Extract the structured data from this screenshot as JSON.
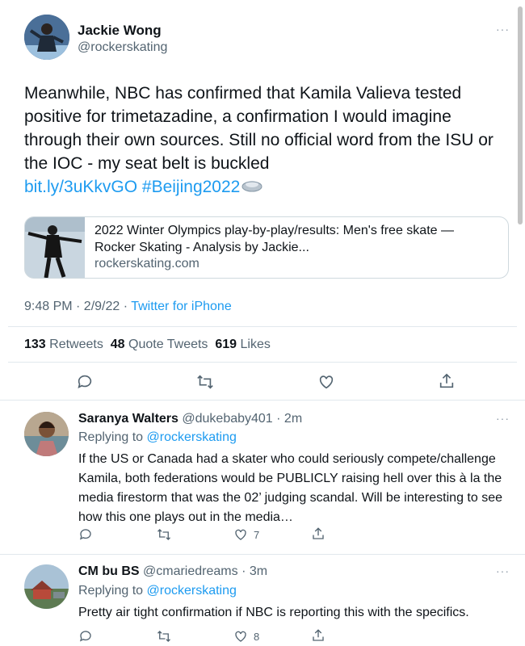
{
  "main_tweet": {
    "name": "Jackie Wong",
    "handle": "@rockerskating",
    "more": "···",
    "text": "Meanwhile, NBC has confirmed that Kamila Valieva tested positive for trimetazadine, a confirmation I would imagine through their own sources. Still no official word from the ISU or the IOC - my seat belt is buckled",
    "link": "bit.ly/3uKkvGO",
    "hashtag": "#Beijing2022",
    "card": {
      "title": "2022 Winter Olympics play-by-play/results: Men's free skate — Rocker Skating - Analysis by Jackie...",
      "domain": "rockerskating.com"
    },
    "time": "9:48 PM · 2/9/22 · ",
    "source": "Twitter for iPhone",
    "retweets_count": "133",
    "retweets_label": "Retweets",
    "quote_count": "48",
    "quote_label": "Quote Tweets",
    "likes_count": "619",
    "likes_label": "Likes"
  },
  "replies": [
    {
      "name": "Saranya Walters",
      "handle": "@dukebaby401",
      "time": "· 2m",
      "replying_prefix": "Replying to ",
      "replying_to": "@rockerskating",
      "text": "If the US or Canada had a skater who could seriously compete/challenge Kamila, both federations would be PUBLICLY raising hell over this à la the media firestorm that was the 02’ judging scandal. Will be interesting to see how this one plays out in the media…",
      "likes": "7"
    },
    {
      "name": "CM bu BS",
      "handle": "@cmariedreams",
      "time": "· 3m",
      "replying_prefix": "Replying to ",
      "replying_to": "@rockerskating",
      "text": "Pretty air tight confirmation if NBC is reporting this with the specifics.",
      "likes": "8"
    }
  ],
  "icons": [
    "reply-icon",
    "retweet-icon",
    "like-icon",
    "share-icon",
    "more-icon"
  ],
  "colors": {
    "link": "#1d9bf0",
    "secondary": "#536471",
    "text": "#0f1419",
    "border": "#cfd9de"
  }
}
